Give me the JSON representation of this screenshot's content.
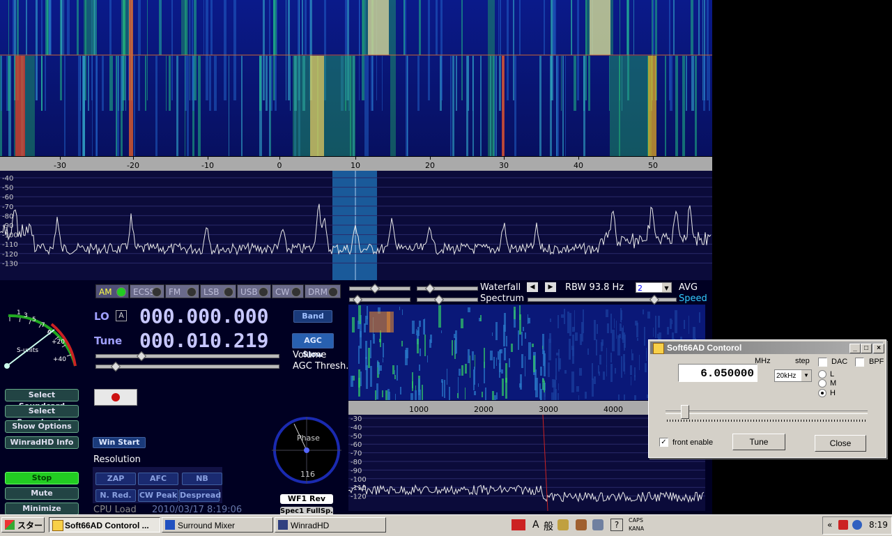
{
  "main_axis": {
    "ticks": [
      "-30",
      "-20",
      "-10",
      "0",
      "10",
      "20",
      "30",
      "40",
      "50"
    ]
  },
  "main_spec": {
    "db": [
      "-40",
      "-50",
      "-60",
      "-70",
      "-80",
      "-90",
      "-100",
      "-110",
      "-120",
      "-130"
    ]
  },
  "modes": [
    {
      "label": "AM",
      "active": true
    },
    {
      "label": "ECSS",
      "active": false
    },
    {
      "label": "FM",
      "active": false
    },
    {
      "label": "LSB",
      "active": false
    },
    {
      "label": "USB",
      "active": false
    },
    {
      "label": "CW",
      "active": false
    },
    {
      "label": "DRM",
      "active": false
    }
  ],
  "lo": {
    "label": "LO",
    "badge": "A",
    "value": "000.000.000"
  },
  "tune": {
    "label": "Tune",
    "value": "000.010.219"
  },
  "band_label": "Band",
  "agc_label": "AGC Slow",
  "volume_label": "Volume",
  "agcthresh_label": "AGC Thresh.",
  "smeter": {
    "ticks": [
      "1",
      "3",
      "5",
      "7",
      "9",
      "+20",
      "+40"
    ],
    "label": "S-units"
  },
  "left_buttons": [
    "Select Soundcard",
    "Select Samplerate",
    "Show Options",
    "WinradHD Info"
  ],
  "stop_label": "Stop",
  "mute_label": "Mute",
  "minimize_label": "Minimize",
  "win_start_label": "Win Start",
  "resolution_label": "Resolution",
  "dsp_buttons": [
    "ZAP",
    "AFC",
    "NB",
    "N. Red.",
    "CW Peak",
    "Despread"
  ],
  "cpu_label": "CPU Load",
  "datetime": "2010/03/17 8:19:06",
  "phase": {
    "label": "Phase",
    "value": "116"
  },
  "wf1_label": "WF1 Rev",
  "spec_label": "Spec1 FullSp.",
  "waterfall_label": "Waterfall",
  "spectrum_label": "Spectrum",
  "rbw_label": "RBW 93.8 Hz",
  "avg_value": "2",
  "avg_label": "AVG",
  "speed_label": "Speed",
  "sub_axis": {
    "ticks": [
      "1000",
      "2000",
      "3000",
      "4000"
    ]
  },
  "sub_spec": {
    "db": [
      "-30",
      "-40",
      "-50",
      "-60",
      "-70",
      "-80",
      "-90",
      "-100",
      "-110",
      "-120"
    ]
  },
  "dialog": {
    "title": "Soft66AD Contorol",
    "mhz": "MHz",
    "freq": "6.050000",
    "step_label": "step",
    "step_value": "20kHz",
    "dac": "DAC",
    "bpf": "BPF",
    "radio": [
      "L",
      "M",
      "H"
    ],
    "front_enable": "front enable",
    "tune": "Tune",
    "close": "Close"
  },
  "taskbar": {
    "start": "スタート",
    "tasks": [
      "Soft66AD Contorol ...",
      "Surround Mixer",
      "WinradHD"
    ],
    "ime": [
      "A",
      "般"
    ],
    "caps": "CAPS",
    "kana": "KANA",
    "time": "8:19"
  }
}
